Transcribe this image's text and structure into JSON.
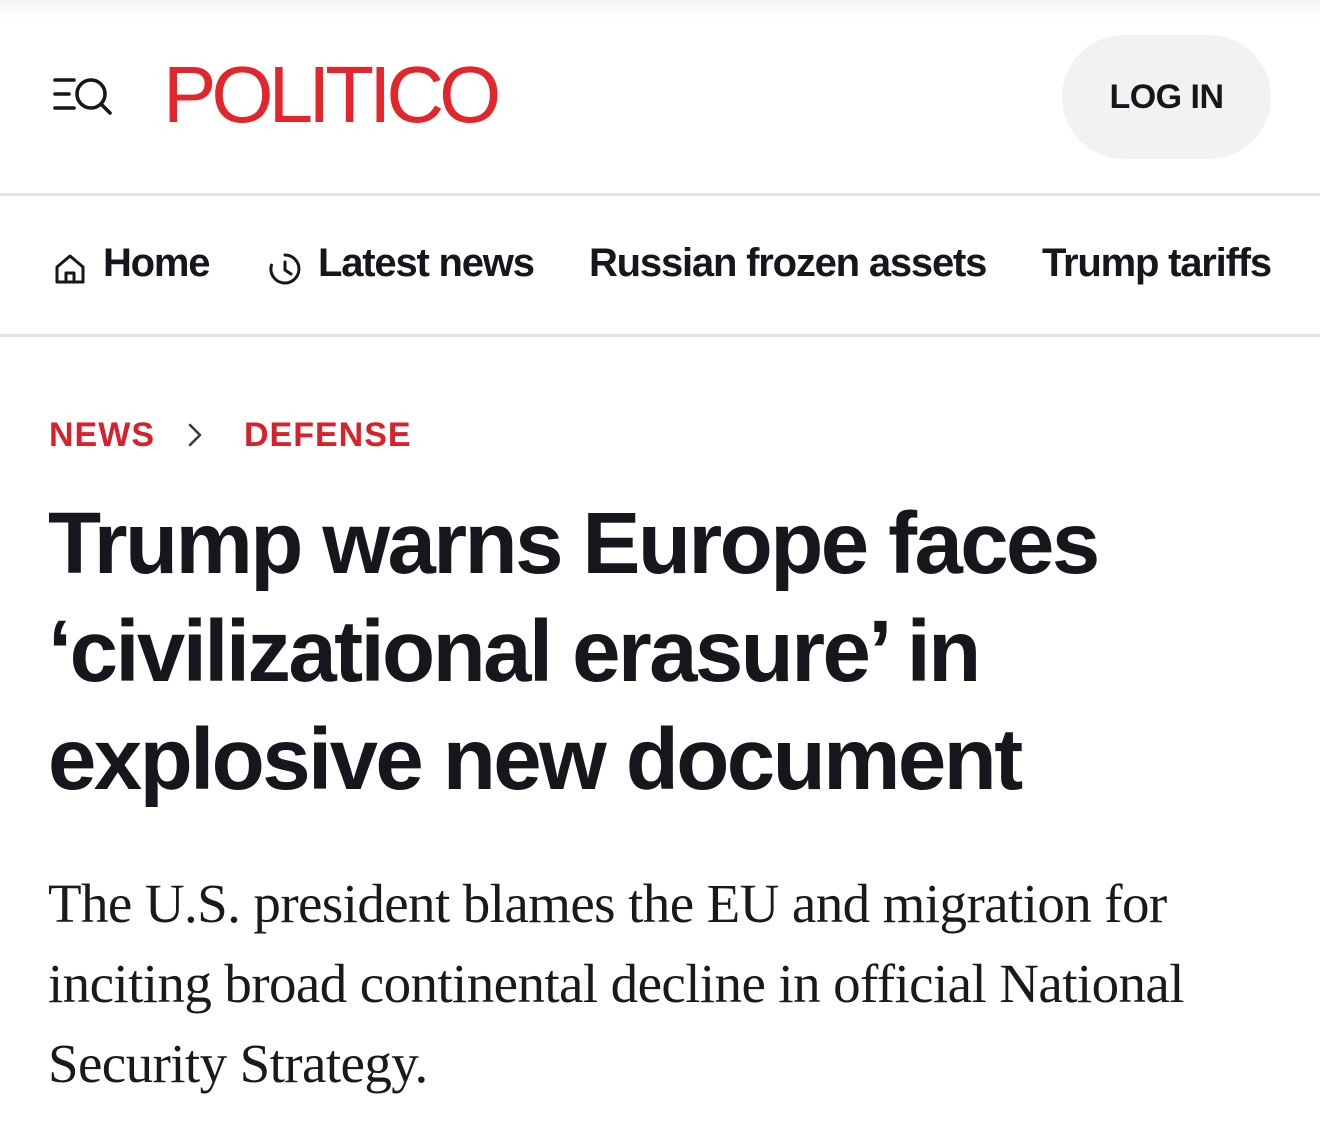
{
  "header": {
    "logo_text": "POLITICO",
    "menu_icon": "menu-search-icon",
    "login_label": "LOG IN"
  },
  "nav": {
    "items": [
      {
        "label": "Home",
        "icon": "home-icon"
      },
      {
        "label": "Latest news",
        "icon": "clock-icon"
      },
      {
        "label": "Russian frozen assets"
      },
      {
        "label": "Trump tariffs"
      }
    ]
  },
  "breadcrumb": {
    "items": [
      "NEWS",
      "DEFENSE"
    ],
    "separator_icon": "chevron-right-icon"
  },
  "article": {
    "headline": "Trump warns Europe faces ‘civilizational erasure’ in explosive new document",
    "dek": "The U.S. president blames the EU and migration for inciting broad continental decline in official National Security Strategy."
  },
  "colors": {
    "brand_red": "#e1262c",
    "crumb_red": "#d6222a",
    "text": "#16161d",
    "button_bg": "#f2f2f2",
    "divider": "#e2e2e2"
  }
}
